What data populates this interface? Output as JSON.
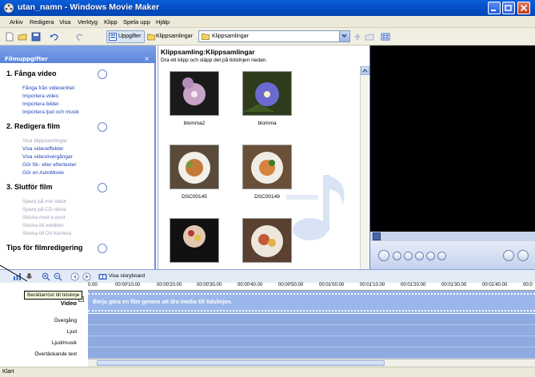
{
  "window": {
    "title": "utan_namn - Windows Movie Maker"
  },
  "menu": [
    "Arkiv",
    "Redigera",
    "Visa",
    "Verktyg",
    "Klipp",
    "Spela upp",
    "Hjälp"
  ],
  "toolbar": {
    "tasks_label": "Uppgifter",
    "collections_label": "Klippsamlingar",
    "combo_value": "Klippsamlingar"
  },
  "taskpane": {
    "header": "Filmuppgifter",
    "sections": [
      {
        "title": "1. Fånga video",
        "links": [
          "Fånga från videoenhet",
          "Importera video",
          "Importera bilder",
          "Importera ljud och musik"
        ],
        "disabled": [
          false,
          false,
          false,
          false
        ]
      },
      {
        "title": "2. Redigera film",
        "links": [
          "Visa klippsamlingar",
          "Visa videoeffekter",
          "Visa videoövergångar",
          "Gör för- eller eftertexter",
          "Gör en AutoMovie"
        ],
        "disabled": [
          true,
          false,
          false,
          false,
          false
        ]
      },
      {
        "title": "3. Slutför film",
        "links": [
          "Spara på min dator",
          "Spara på CD-skiva",
          "Skicka med e-post",
          "Skicka till webben",
          "Skicka till DV-kamera"
        ],
        "disabled": [
          true,
          true,
          true,
          true,
          true
        ]
      },
      {
        "title": "Tips för filmredigering",
        "links": [],
        "disabled": []
      }
    ]
  },
  "collection": {
    "title": "Klippsamling:Klippsamlingar",
    "subtitle": "Dra ett klipp och släpp det på tidslinjen nedan.",
    "clips": [
      "blomma2",
      "blomma",
      "DSC00145",
      "DSC00149",
      "",
      ""
    ]
  },
  "timeline": {
    "storyboard_label": "Visa storyboard",
    "tooltip": "Berättarröst till tidslinje",
    "ticks": [
      "0.00",
      "00:00'10.00",
      "00:00'20.00",
      "00:00'30.00",
      "00:00'40.00",
      "00:00'50.00",
      "00:01'00.00",
      "00:01'10.00",
      "00:01'20.00",
      "00:01'30.00",
      "00:01'40.00",
      "00:0"
    ],
    "tracks": [
      "Video",
      "Övergång",
      "Ljud",
      "Ljud/musik",
      "Övertäckande text"
    ],
    "video_hint": "Börja göra en film genom att dra media till tidslinjen."
  },
  "status": {
    "text": "Klart"
  },
  "colors": {
    "titlebar": "#0450c8",
    "taskpane": "#7ba2e7",
    "timeline": "#8eaae0",
    "link": "#2144b8"
  }
}
